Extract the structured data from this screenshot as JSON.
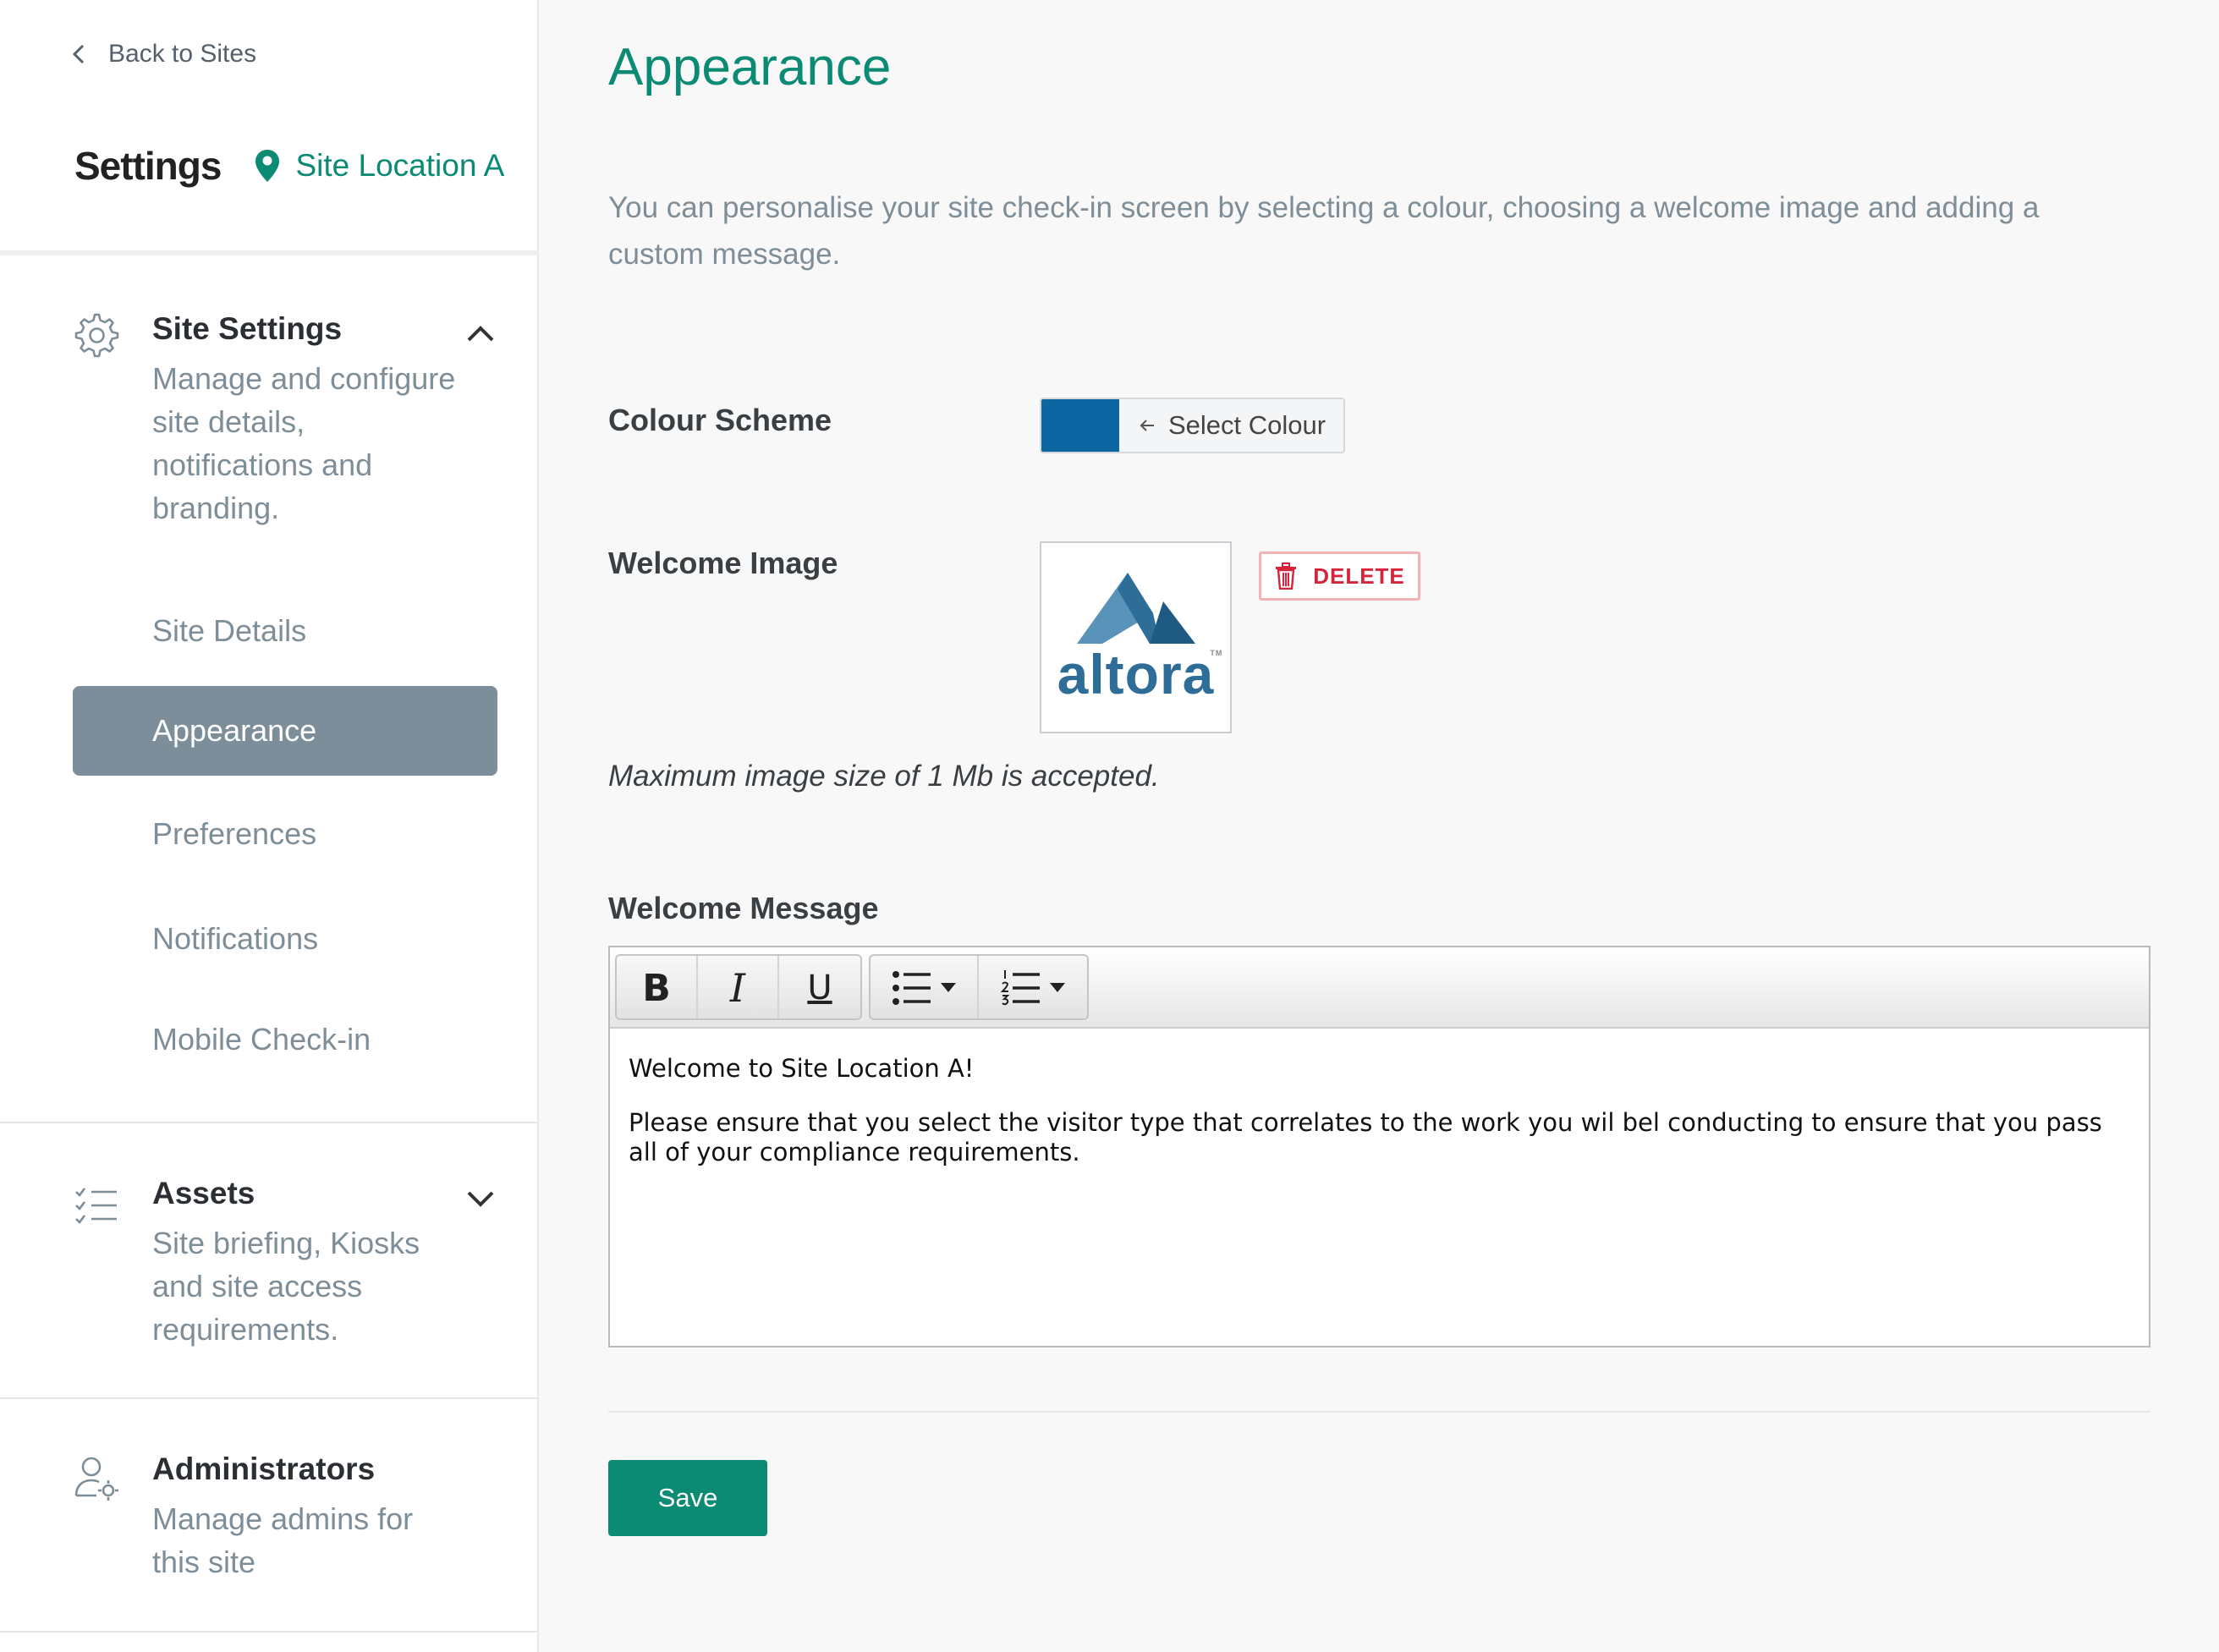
{
  "sidebar": {
    "back_label": "Back to Sites",
    "settings_title": "Settings",
    "site_location": "Site Location A",
    "sections": {
      "site_settings": {
        "title": "Site Settings",
        "description": "Manage and configure site details, notifications and branding.",
        "expanded": true,
        "items": [
          {
            "label": "Site Details",
            "active": false
          },
          {
            "label": "Appearance",
            "active": true
          },
          {
            "label": "Preferences",
            "active": false
          },
          {
            "label": "Notifications",
            "active": false
          },
          {
            "label": "Mobile Check-in",
            "active": false
          }
        ]
      },
      "assets": {
        "title": "Assets",
        "description": "Site briefing, Kiosks and site access requirements.",
        "expanded": false
      },
      "administrators": {
        "title": "Administrators",
        "description": "Manage admins for this site"
      }
    }
  },
  "main": {
    "title": "Appearance",
    "intro": "You can personalise your site check-in screen by selecting a colour, choosing a welcome image and adding a custom message.",
    "colour_scheme": {
      "label": "Colour Scheme",
      "button_label": "Select Colour",
      "selected_colour": "#0b66a2"
    },
    "welcome_image": {
      "label": "Welcome Image",
      "logo_text": "altora",
      "logo_tm": "TM",
      "delete_label": "DELETE",
      "note": "Maximum image size of 1 Mb is accepted."
    },
    "welcome_message": {
      "label": "Welcome Message",
      "line1": "Welcome to Site Location A!",
      "line2": "Please ensure that you select the visitor type that correlates to the work you wil bel conducting to ensure that you pass all of your compliance requirements."
    },
    "save_label": "Save"
  },
  "colors": {
    "accent": "#0b8a74",
    "active_nav": "#7b8e99",
    "muted_text": "#7e8e98",
    "danger": "#d6243a"
  }
}
